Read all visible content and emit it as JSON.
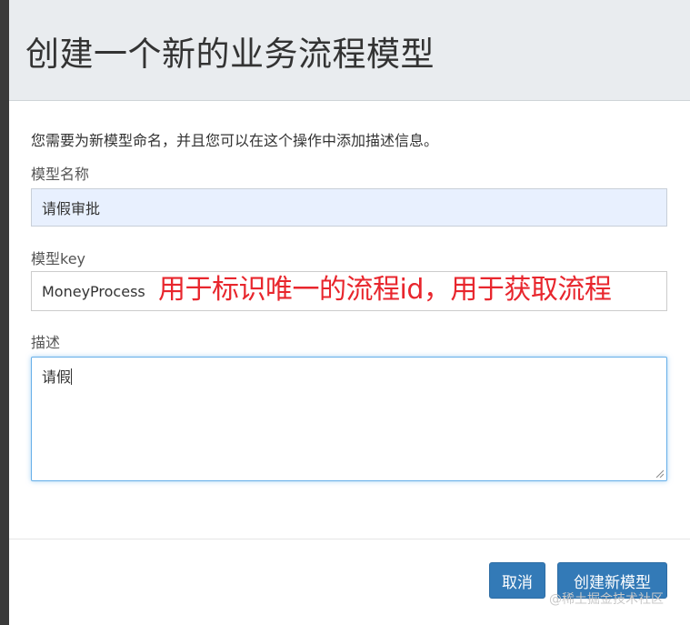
{
  "dialog": {
    "title": "创建一个新的业务流程模型",
    "intro": "您需要为新模型命名，并且您可以在这个操作中添加描述信息。"
  },
  "form": {
    "name_label": "模型名称",
    "name_value": "请假审批",
    "key_label": "模型key",
    "key_value": "MoneyProcess",
    "description_label": "描述",
    "description_value": "请假"
  },
  "annotation": "用于标识唯一的流程id，用于获取流程",
  "buttons": {
    "cancel": "取消",
    "create": "创建新模型"
  },
  "watermark": "@稀土掘金技术社区",
  "colors": {
    "primary": "#337ab7",
    "annotation": "#e8262d",
    "header_bg": "#e9ecef",
    "autofill_bg": "#e8f0fe"
  }
}
